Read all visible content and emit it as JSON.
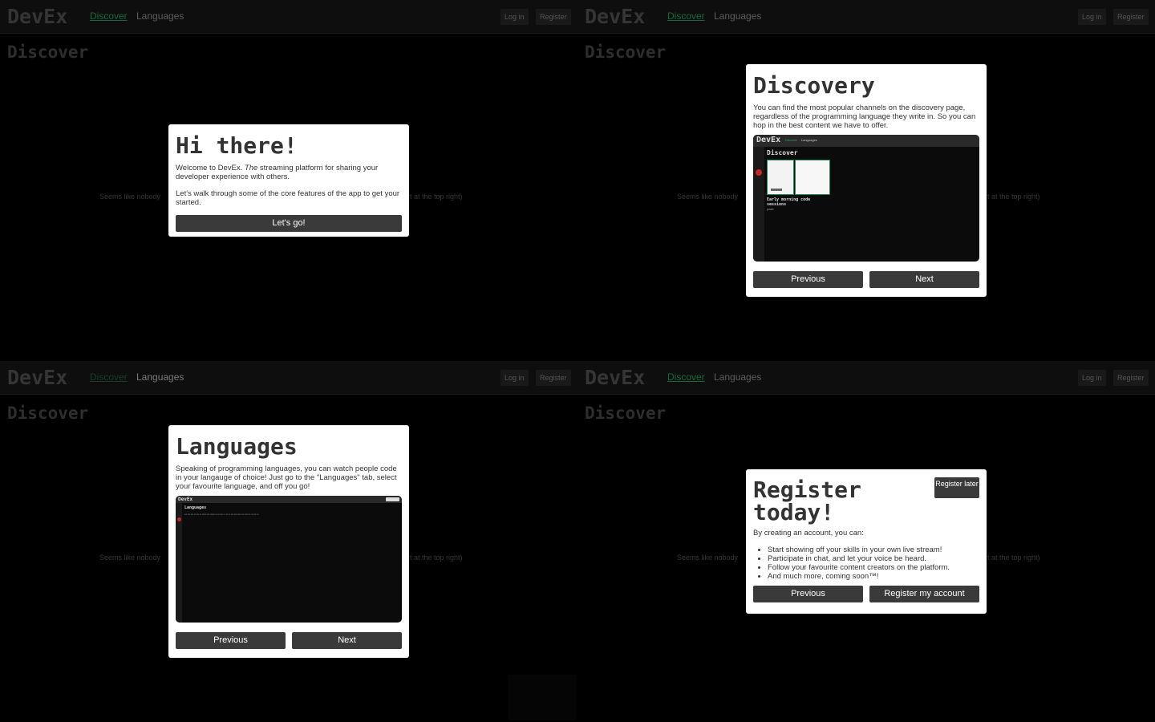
{
  "nav": {
    "brand": "DevEx",
    "discover": "Discover",
    "languages": "Languages",
    "login": "Log in",
    "register": "Register"
  },
  "page": {
    "title": "Discover",
    "empty_left": "Seems like nobody",
    "empty_right": "rt at the top right)"
  },
  "welcome": {
    "title": "Hi there!",
    "text_prefix": "Welcome to DevEx. ",
    "text_em": "The",
    "text_suffix": " streaming platform for sharing your developer experience with others.",
    "text2": "Let's walk through some of the core features of the app to get your started.",
    "button": "Let's go!"
  },
  "discovery": {
    "title": "Discovery",
    "text": "You can find the most popular channels on the discovery page, regardless of the programming language they write in. So you can hop in the best content we have to offer.",
    "preview": {
      "brand": "DevEx",
      "nav1": "Discover",
      "nav2": "Languages",
      "title": "Discover",
      "caption": "Early morning code sessions",
      "author": "jonah"
    },
    "prev": "Previous",
    "next": "Next"
  },
  "languages": {
    "title": "Languages",
    "text": "Speaking of programming languages, you can watch people code in your langauge of choice! Just go to the \"Languages\" tab, select your favourite language, and off you go!",
    "preview": {
      "brand": "DevEx",
      "title": "Languages"
    },
    "prev": "Previous",
    "next": "Next"
  },
  "register": {
    "title": "Register today!",
    "later": "Register later",
    "intro": "By creating an account, you can:",
    "items": [
      "Start showing off your skills in your own live stream!",
      "Participate in chat, and let your voice be heard.",
      "Follow your favourite content creators on the platform.",
      "And much more, coming soon™!"
    ],
    "prev": "Previous",
    "submit": "Register my account"
  }
}
